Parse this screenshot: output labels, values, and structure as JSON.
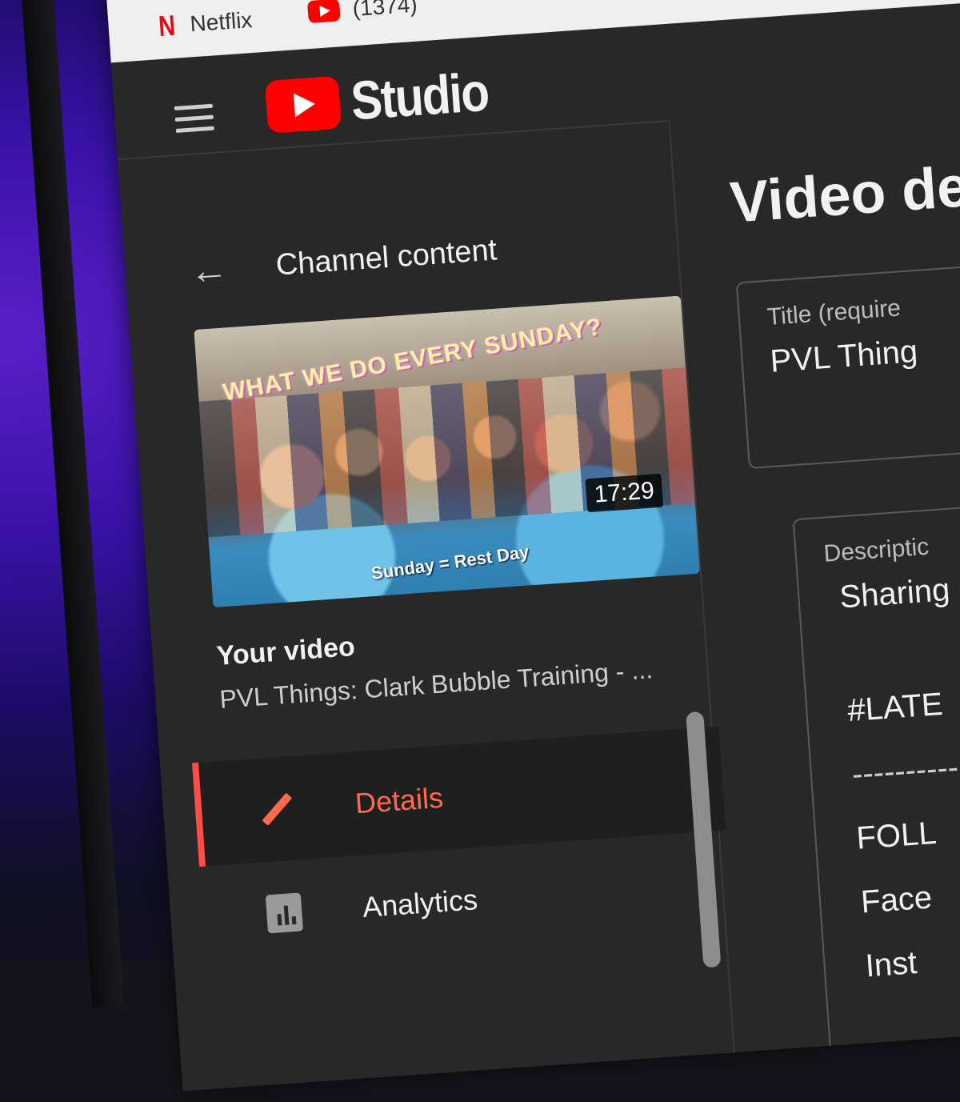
{
  "browser": {
    "bookmarks": [
      {
        "label": "Netflix"
      },
      {
        "label": "(1374)"
      }
    ]
  },
  "studio": {
    "logo_text": "Studio"
  },
  "sidebar": {
    "back_label": "Channel content",
    "thumbnail": {
      "headline": "WHAT WE DO EVERY SUNDAY?",
      "caption": "Sunday = Rest Day",
      "duration": "17:29"
    },
    "your_video_label": "Your video",
    "video_title": "PVL Things: Clark Bubble Training - ...",
    "nav": [
      {
        "label": "Details",
        "active": true,
        "icon": "pencil-icon"
      },
      {
        "label": "Analytics",
        "active": false,
        "icon": "analytics-icon"
      }
    ]
  },
  "main": {
    "page_title": "Video del",
    "title_field": {
      "label": "Title (require",
      "value": "PVL Thing"
    },
    "description_field": {
      "label": "Descriptic",
      "lines": [
        "Sharing",
        "#LATE",
        "----------",
        "FOLL",
        "Face",
        "Inst"
      ]
    }
  },
  "colors": {
    "accent": "#ff4e45",
    "youtube_red": "#ff0000",
    "background": "#282828"
  }
}
